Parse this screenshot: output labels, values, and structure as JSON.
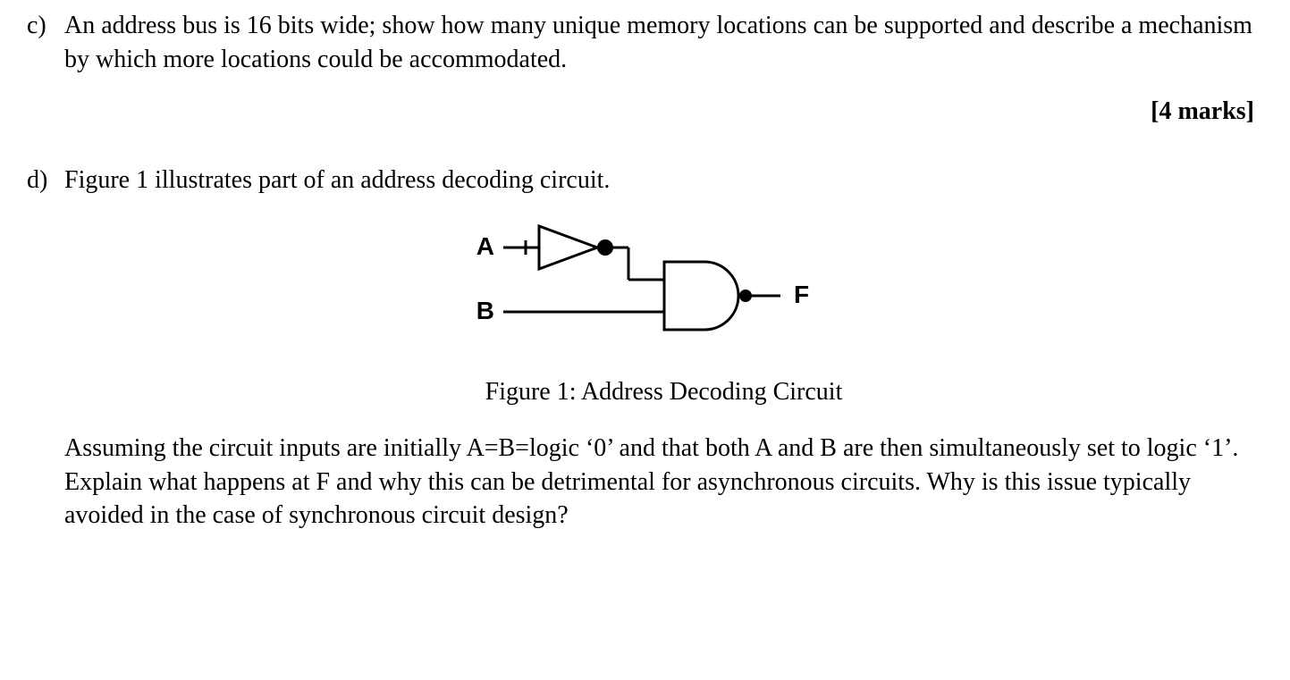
{
  "question_c": {
    "label": "c)",
    "text": "An address bus is 16 bits wide; show how many unique memory locations can be supported and describe a mechanism by which more locations could be accommodated.",
    "marks": "[4 marks]"
  },
  "question_d": {
    "label": "d)",
    "intro": "Figure 1 illustrates part of an address decoding circuit.",
    "figure": {
      "input_a": "A",
      "input_b": "B",
      "output_f": "F",
      "caption": "Figure 1: Address Decoding Circuit"
    },
    "body": "Assuming the circuit inputs are initially A=B=logic ‘0’ and that both A and B are then simultaneously set to logic ‘1’. Explain what happens at F and why this can be detrimental for asynchronous circuits. Why is this issue typically avoided in the case of synchronous circuit design?"
  }
}
